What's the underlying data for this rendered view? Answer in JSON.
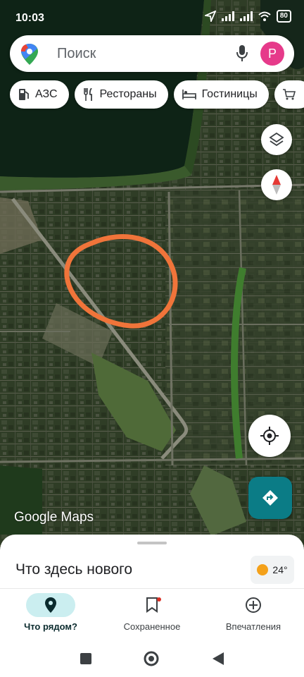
{
  "status": {
    "time": "10:03",
    "battery": "80"
  },
  "search": {
    "placeholder": "Поиск",
    "avatar_letter": "P"
  },
  "chips": [
    {
      "label": "АЗС",
      "icon": "gas-station-icon"
    },
    {
      "label": "Рестораны",
      "icon": "restaurant-icon"
    },
    {
      "label": "Гостиницы",
      "icon": "hotel-icon"
    },
    {
      "label": "",
      "icon": "shopping-cart-icon"
    }
  ],
  "map": {
    "type": "satellite",
    "logo": "Google Maps",
    "annotation": "orange hand-drawn circle"
  },
  "controls": {
    "layers_icon": "layers-icon",
    "compass_icon": "compass-icon",
    "location_icon": "my-location-icon",
    "directions_icon": "directions-icon"
  },
  "sheet": {
    "title": "Что здесь нового",
    "weather": "24°"
  },
  "bottom_nav": [
    {
      "label": "Что рядом?",
      "icon": "location-pin-icon",
      "active": true
    },
    {
      "label": "Сохраненное",
      "icon": "bookmark-icon",
      "active": false
    },
    {
      "label": "Впечатления",
      "icon": "add-circle-icon",
      "active": false
    }
  ],
  "system_nav": {
    "icons": [
      "square-icon",
      "home-circle-icon",
      "back-triangle-icon"
    ]
  }
}
